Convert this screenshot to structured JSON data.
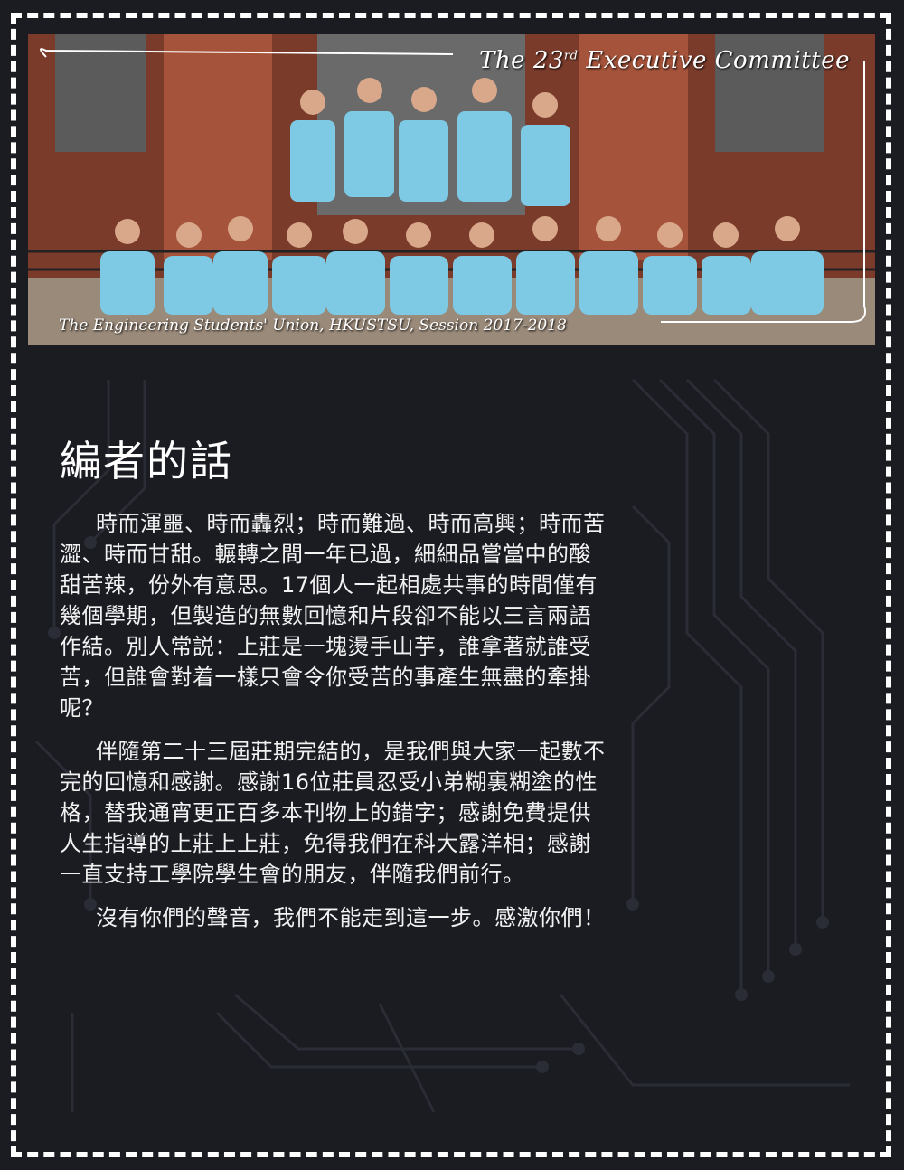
{
  "photo": {
    "title_main": "The 23",
    "title_sup": "rd",
    "title_rest": " Executive Committee",
    "caption": "The Engineering Students' Union, HKUSTSU, Session 2017-2018"
  },
  "heading": "編者的話",
  "paragraphs": [
    "時而渾噩、時而轟烈；時而難過、時而高興；時而苦澀、時而甘甜。輾轉之間一年已過，細細品嘗當中的酸甜苦辣，份外有意思。17個人一起相處共事的時間僅有幾個學期，但製造的無數回憶和片段卻不能以三言兩語作結。別人常説：上莊是一塊燙手山芋，誰拿著就誰受苦，但誰會對着一樣只會令你受苦的事產生無盡的牽掛呢？",
    "伴隨第二十三屆莊期完結的，是我們與大家一起數不完的回憶和感謝。感謝16位莊員忍受小弟糊裏糊塗的性格，替我通宵更正百多本刊物上的錯字；感謝免費提供人生指導的上莊上上莊，免得我們在科大露洋相；感謝一直支持工學院學生會的朋友，伴隨我們前行。",
    "沒有你們的聲音，我們不能走到這一步。感激你們！"
  ]
}
